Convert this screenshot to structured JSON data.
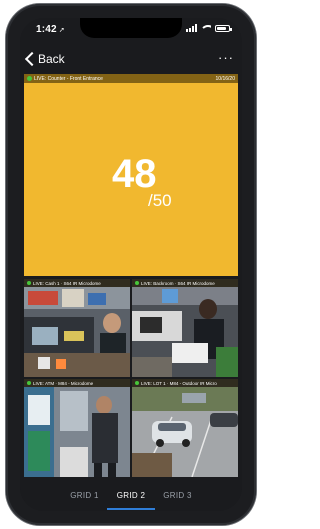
{
  "status_bar": {
    "time": "1:42",
    "location_arrow": "➚"
  },
  "nav": {
    "back_label": "Back",
    "more_label": "···"
  },
  "counter": {
    "live_label": "LIVE: Counter - Front Entrance",
    "date": "10/16/20",
    "count": "48",
    "capacity": "/50"
  },
  "cameras": [
    {
      "label": "LIVE: Cash 1 · S64 IR Microdome"
    },
    {
      "label": "LIVE: Backroom · S64 IR Microdome"
    },
    {
      "label": "LIVE: ATM · M84 - Microdome"
    },
    {
      "label": "LIVE: LOT 1 · M84 - Outdoor IR Micro"
    }
  ],
  "tabs": [
    {
      "label": "GRID 1"
    },
    {
      "label": "GRID 2"
    },
    {
      "label": "GRID 3"
    }
  ],
  "colors": {
    "counter_bg": "#f1b82f",
    "live_green": "#47c63a",
    "tab_active_underline": "#2f7ed8"
  }
}
